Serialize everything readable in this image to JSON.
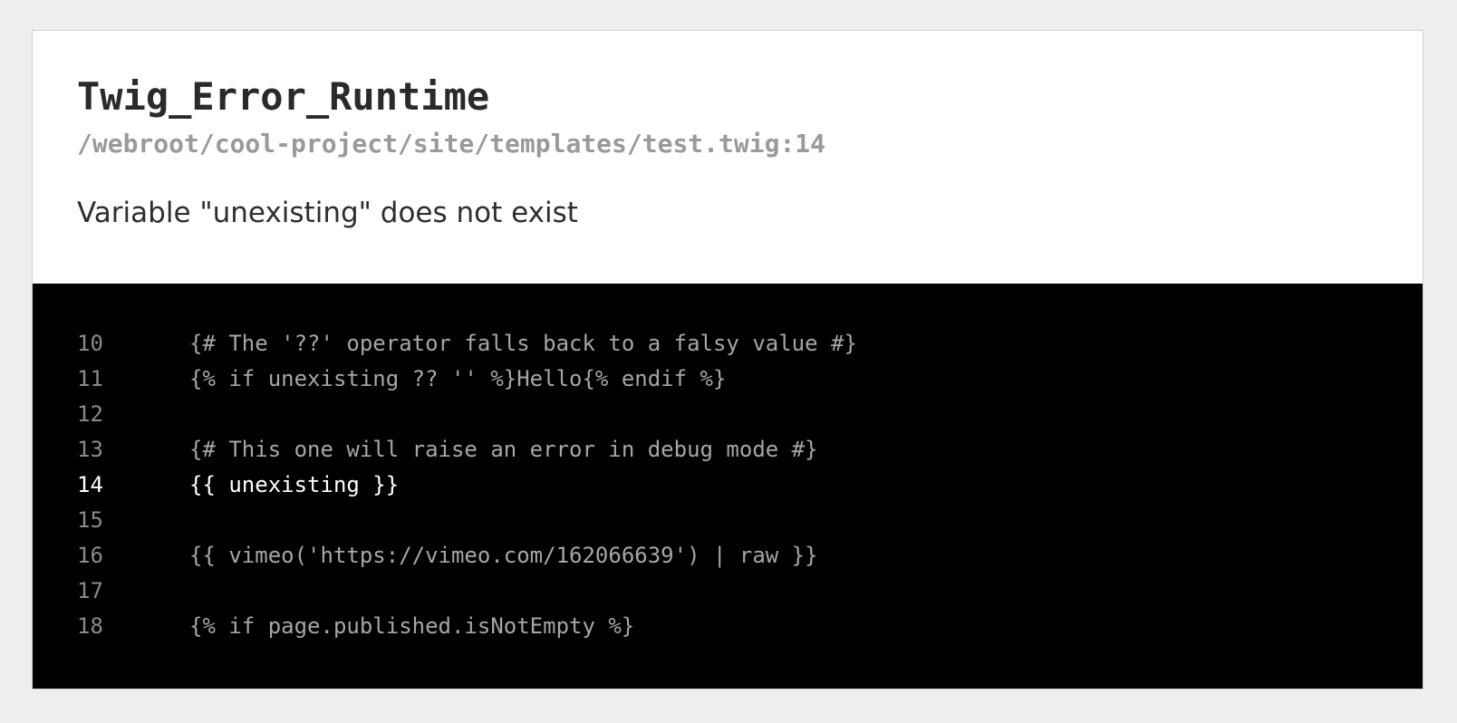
{
  "error": {
    "type": "Twig_Error_Runtime",
    "file": "/webroot/cool-project/site/templates/test.twig:14",
    "message": "Variable \"unexisting\" does not exist"
  },
  "code_lines": [
    {
      "number": "10",
      "code": "{# The '??' operator falls back to a falsy value #}"
    },
    {
      "number": "11",
      "code": "{% if unexisting ?? '' %}Hello{% endif %}"
    },
    {
      "number": "12",
      "code": ""
    },
    {
      "number": "13",
      "code": "{# This one will raise an error in debug mode #}"
    },
    {
      "number": "14",
      "code": "{{ unexisting }}"
    },
    {
      "number": "15",
      "code": ""
    },
    {
      "number": "16",
      "code": "{{ vimeo('https://vimeo.com/162066639') | raw }}"
    },
    {
      "number": "17",
      "code": ""
    },
    {
      "number": "18",
      "code": "{% if page.published.isNotEmpty %}"
    }
  ],
  "highlighted_line": "14",
  "colors": {
    "page_background": "#eeeeee",
    "panel_background": "#ffffff",
    "code_background": "#000000",
    "highlight_text": "#ffffff",
    "muted_text": "#9a9a9a"
  }
}
